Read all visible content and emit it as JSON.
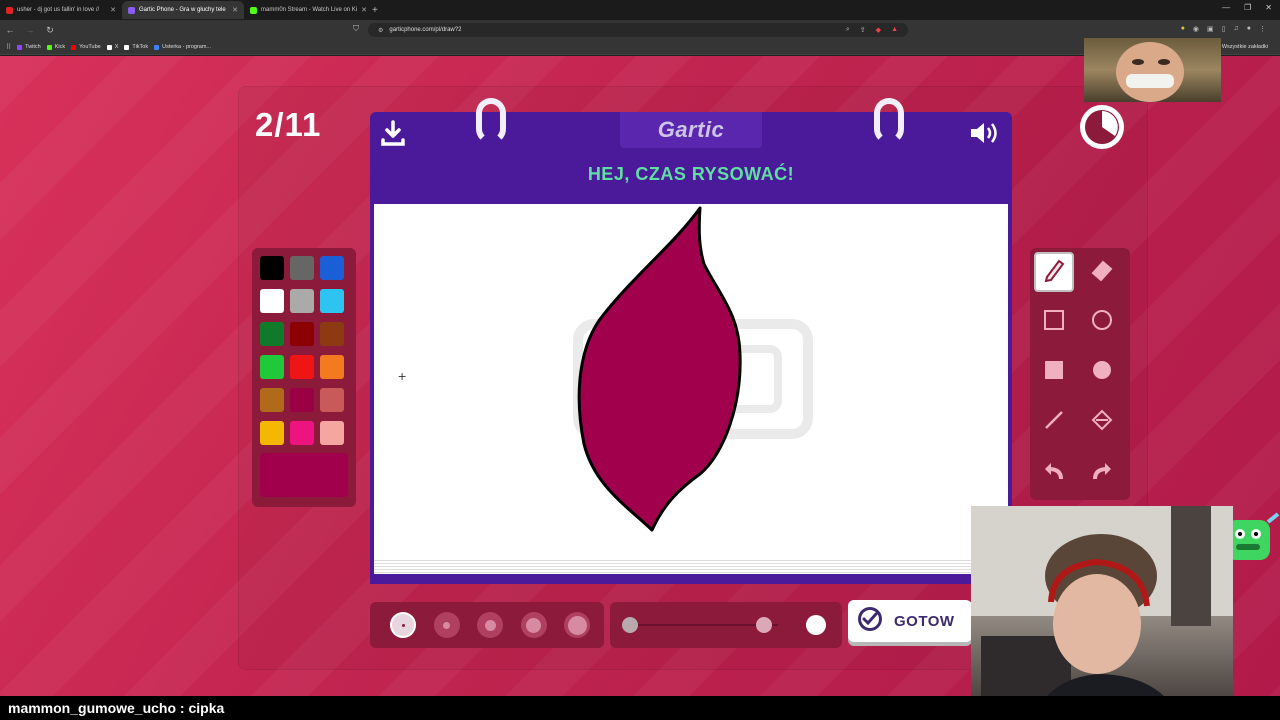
{
  "browser": {
    "tabs": [
      {
        "title": "usher - dj got us fallin' in love //",
        "favicon_color": "#e02424",
        "active": false
      },
      {
        "title": "Gartic Phone - Gra w głuchy tele",
        "favicon_color": "#8a5cf6",
        "active": true
      },
      {
        "title": "mamm0n Stream - Watch Live on Ki",
        "favicon_color": "#53fc18",
        "active": false
      }
    ],
    "new_tab": "+",
    "url": "garticphone.com/pl/draw?2",
    "bookmarks": [
      {
        "label": "Twitch",
        "color": "#9146ff"
      },
      {
        "label": "Kick",
        "color": "#53fc18"
      },
      {
        "label": "YouTube",
        "color": "#ff0000"
      },
      {
        "label": "X",
        "color": "#ffffff"
      },
      {
        "label": "TikTok",
        "color": "#ffffff"
      },
      {
        "label": "Usterka - program...",
        "color": "#3b82f6"
      }
    ],
    "bookmarks_right": "Wszystkie zakładki"
  },
  "game": {
    "round": "2/11",
    "logo": "Gartic",
    "prompt": "HEJ, CZAS RYSOWAĆ!",
    "done_label": "GOTOW",
    "current_color": "#a0004c",
    "palette": [
      "#000000",
      "#666666",
      "#1b5fd6",
      "#ffffff",
      "#aaaaaa",
      "#2ec4f2",
      "#0f7a2a",
      "#8b0000",
      "#8c3a12",
      "#1fc93a",
      "#f01515",
      "#f47a1f",
      "#b06a1a",
      "#9b0045",
      "#c85a5a",
      "#f5b800",
      "#ee1480",
      "#f6a6a0"
    ],
    "tools": [
      "pencil-tool",
      "eraser-tool",
      "rectangle-outline-tool",
      "ellipse-outline-tool",
      "rectangle-fill-tool",
      "ellipse-fill-tool",
      "line-tool",
      "fill-bucket-tool",
      "undo-tool",
      "redo-tool"
    ],
    "selected_tool": "pencil-tool",
    "brush_sizes": 5,
    "selected_brush_size": 1,
    "opacity_level": 0.9
  },
  "chat": {
    "username": "mammon_gumowe_ucho",
    "separator": " : ",
    "message": "cipka"
  }
}
